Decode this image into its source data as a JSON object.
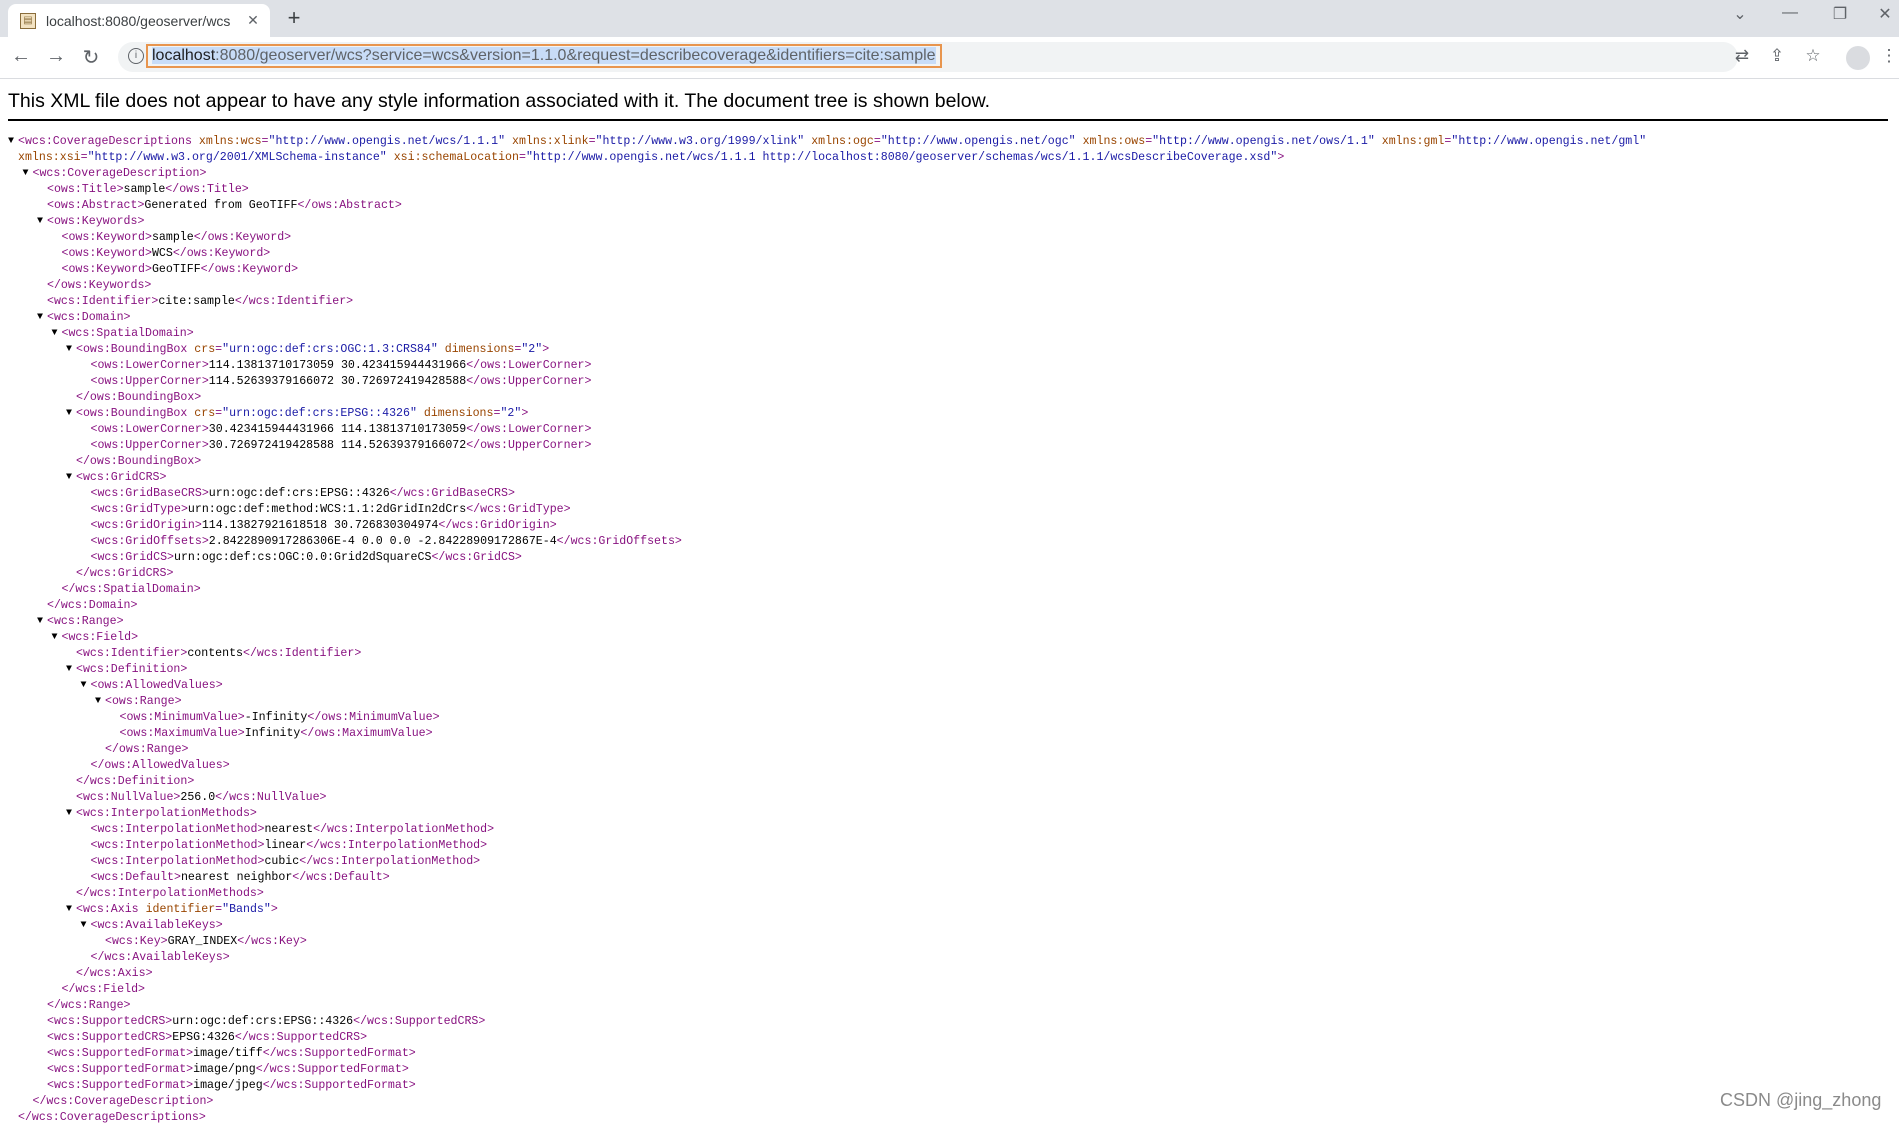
{
  "browser": {
    "tab_title": "localhost:8080/geoserver/wcs",
    "url_host": "localhost",
    "url_rest": ":8080/geoserver/wcs?service=wcs&version=1.1.0&request=describecoverage&identifiers=cite:sample"
  },
  "notice": "This XML file does not appear to have any style information associated with it. The document tree is shown below.",
  "watermark": "CSDN @jing_zhong",
  "icons": {
    "new_tab": "+",
    "tab_close": "✕",
    "back": "←",
    "forward": "→",
    "reload": "↻",
    "minimize": "—",
    "restore": "❐",
    "close": "✕",
    "dropdown": "⌄",
    "translate": "⇄",
    "share": "⇪",
    "star": "☆",
    "menu": "⋮",
    "info": "i",
    "toggle_open": "▼"
  },
  "xml_lines": [
    {
      "indent": 0,
      "toggle": true,
      "parts": [
        {
          "t": "tag",
          "v": "<wcs:CoverageDescriptions "
        },
        {
          "t": "an",
          "v": "xmlns:wcs"
        },
        {
          "t": "tag",
          "v": "="
        },
        {
          "t": "av",
          "v": "\"http://www.opengis.net/wcs/1.1.1\""
        },
        {
          "t": "an",
          "v": " xmlns:xlink"
        },
        {
          "t": "tag",
          "v": "="
        },
        {
          "t": "av",
          "v": "\"http://www.w3.org/1999/xlink\""
        },
        {
          "t": "an",
          "v": " xmlns:ogc"
        },
        {
          "t": "tag",
          "v": "="
        },
        {
          "t": "av",
          "v": "\"http://www.opengis.net/ogc\""
        },
        {
          "t": "an",
          "v": " xmlns:ows"
        },
        {
          "t": "tag",
          "v": "="
        },
        {
          "t": "av",
          "v": "\"http://www.opengis.net/ows/1.1\""
        },
        {
          "t": "an",
          "v": " xmlns:gml"
        },
        {
          "t": "tag",
          "v": "="
        },
        {
          "t": "av",
          "v": "\"http://www.opengis.net/gml\""
        }
      ]
    },
    {
      "indent": 0,
      "toggle": false,
      "parts": [
        {
          "t": "an",
          "v": "xmlns:xsi"
        },
        {
          "t": "tag",
          "v": "="
        },
        {
          "t": "av",
          "v": "\"http://www.w3.org/2001/XMLSchema-instance\""
        },
        {
          "t": "an",
          "v": " xsi:schemaLocation"
        },
        {
          "t": "tag",
          "v": "="
        },
        {
          "t": "av",
          "v": "\"http://www.opengis.net/wcs/1.1.1 http://localhost:8080/geoserver/schemas/wcs/1.1.1/wcsDescribeCoverage.xsd\""
        },
        {
          "t": "tag",
          "v": ">"
        }
      ]
    },
    {
      "indent": 1,
      "toggle": true,
      "parts": [
        {
          "t": "tag",
          "v": "<wcs:CoverageDescription>"
        }
      ]
    },
    {
      "indent": 2,
      "toggle": false,
      "parts": [
        {
          "t": "tag",
          "v": "<ows:Title>"
        },
        {
          "t": "txt",
          "v": "sample"
        },
        {
          "t": "tag",
          "v": "</ows:Title>"
        }
      ]
    },
    {
      "indent": 2,
      "toggle": false,
      "parts": [
        {
          "t": "tag",
          "v": "<ows:Abstract>"
        },
        {
          "t": "txt",
          "v": "Generated from GeoTIFF"
        },
        {
          "t": "tag",
          "v": "</ows:Abstract>"
        }
      ]
    },
    {
      "indent": 2,
      "toggle": true,
      "parts": [
        {
          "t": "tag",
          "v": "<ows:Keywords>"
        }
      ]
    },
    {
      "indent": 3,
      "toggle": false,
      "parts": [
        {
          "t": "tag",
          "v": "<ows:Keyword>"
        },
        {
          "t": "txt",
          "v": "sample"
        },
        {
          "t": "tag",
          "v": "</ows:Keyword>"
        }
      ]
    },
    {
      "indent": 3,
      "toggle": false,
      "parts": [
        {
          "t": "tag",
          "v": "<ows:Keyword>"
        },
        {
          "t": "txt",
          "v": "WCS"
        },
        {
          "t": "tag",
          "v": "</ows:Keyword>"
        }
      ]
    },
    {
      "indent": 3,
      "toggle": false,
      "parts": [
        {
          "t": "tag",
          "v": "<ows:Keyword>"
        },
        {
          "t": "txt",
          "v": "GeoTIFF"
        },
        {
          "t": "tag",
          "v": "</ows:Keyword>"
        }
      ]
    },
    {
      "indent": 2,
      "toggle": false,
      "parts": [
        {
          "t": "tag",
          "v": "</ows:Keywords>"
        }
      ]
    },
    {
      "indent": 2,
      "toggle": false,
      "parts": [
        {
          "t": "tag",
          "v": "<wcs:Identifier>"
        },
        {
          "t": "txt",
          "v": "cite:sample"
        },
        {
          "t": "tag",
          "v": "</wcs:Identifier>"
        }
      ]
    },
    {
      "indent": 2,
      "toggle": true,
      "parts": [
        {
          "t": "tag",
          "v": "<wcs:Domain>"
        }
      ]
    },
    {
      "indent": 3,
      "toggle": true,
      "parts": [
        {
          "t": "tag",
          "v": "<wcs:SpatialDomain>"
        }
      ]
    },
    {
      "indent": 4,
      "toggle": true,
      "parts": [
        {
          "t": "tag",
          "v": "<ows:BoundingBox "
        },
        {
          "t": "an",
          "v": "crs"
        },
        {
          "t": "tag",
          "v": "="
        },
        {
          "t": "av",
          "v": "\"urn:ogc:def:crs:OGC:1.3:CRS84\""
        },
        {
          "t": "an",
          "v": " dimensions"
        },
        {
          "t": "tag",
          "v": "="
        },
        {
          "t": "av",
          "v": "\"2\""
        },
        {
          "t": "tag",
          "v": ">"
        }
      ]
    },
    {
      "indent": 5,
      "toggle": false,
      "parts": [
        {
          "t": "tag",
          "v": "<ows:LowerCorner>"
        },
        {
          "t": "txt",
          "v": "114.13813710173059 30.423415944431966"
        },
        {
          "t": "tag",
          "v": "</ows:LowerCorner>"
        }
      ]
    },
    {
      "indent": 5,
      "toggle": false,
      "parts": [
        {
          "t": "tag",
          "v": "<ows:UpperCorner>"
        },
        {
          "t": "txt",
          "v": "114.52639379166072 30.726972419428588"
        },
        {
          "t": "tag",
          "v": "</ows:UpperCorner>"
        }
      ]
    },
    {
      "indent": 4,
      "toggle": false,
      "parts": [
        {
          "t": "tag",
          "v": "</ows:BoundingBox>"
        }
      ]
    },
    {
      "indent": 4,
      "toggle": true,
      "parts": [
        {
          "t": "tag",
          "v": "<ows:BoundingBox "
        },
        {
          "t": "an",
          "v": "crs"
        },
        {
          "t": "tag",
          "v": "="
        },
        {
          "t": "av",
          "v": "\"urn:ogc:def:crs:EPSG::4326\""
        },
        {
          "t": "an",
          "v": " dimensions"
        },
        {
          "t": "tag",
          "v": "="
        },
        {
          "t": "av",
          "v": "\"2\""
        },
        {
          "t": "tag",
          "v": ">"
        }
      ]
    },
    {
      "indent": 5,
      "toggle": false,
      "parts": [
        {
          "t": "tag",
          "v": "<ows:LowerCorner>"
        },
        {
          "t": "txt",
          "v": "30.423415944431966 114.13813710173059"
        },
        {
          "t": "tag",
          "v": "</ows:LowerCorner>"
        }
      ]
    },
    {
      "indent": 5,
      "toggle": false,
      "parts": [
        {
          "t": "tag",
          "v": "<ows:UpperCorner>"
        },
        {
          "t": "txt",
          "v": "30.726972419428588 114.52639379166072"
        },
        {
          "t": "tag",
          "v": "</ows:UpperCorner>"
        }
      ]
    },
    {
      "indent": 4,
      "toggle": false,
      "parts": [
        {
          "t": "tag",
          "v": "</ows:BoundingBox>"
        }
      ]
    },
    {
      "indent": 4,
      "toggle": true,
      "parts": [
        {
          "t": "tag",
          "v": "<wcs:GridCRS>"
        }
      ]
    },
    {
      "indent": 5,
      "toggle": false,
      "parts": [
        {
          "t": "tag",
          "v": "<wcs:GridBaseCRS>"
        },
        {
          "t": "txt",
          "v": "urn:ogc:def:crs:EPSG::4326"
        },
        {
          "t": "tag",
          "v": "</wcs:GridBaseCRS>"
        }
      ]
    },
    {
      "indent": 5,
      "toggle": false,
      "parts": [
        {
          "t": "tag",
          "v": "<wcs:GridType>"
        },
        {
          "t": "txt",
          "v": "urn:ogc:def:method:WCS:1.1:2dGridIn2dCrs"
        },
        {
          "t": "tag",
          "v": "</wcs:GridType>"
        }
      ]
    },
    {
      "indent": 5,
      "toggle": false,
      "parts": [
        {
          "t": "tag",
          "v": "<wcs:GridOrigin>"
        },
        {
          "t": "txt",
          "v": "114.13827921618518 30.726830304974"
        },
        {
          "t": "tag",
          "v": "</wcs:GridOrigin>"
        }
      ]
    },
    {
      "indent": 5,
      "toggle": false,
      "parts": [
        {
          "t": "tag",
          "v": "<wcs:GridOffsets>"
        },
        {
          "t": "txt",
          "v": "2.8422890917286306E-4 0.0 0.0 -2.84228909172867E-4"
        },
        {
          "t": "tag",
          "v": "</wcs:GridOffsets>"
        }
      ]
    },
    {
      "indent": 5,
      "toggle": false,
      "parts": [
        {
          "t": "tag",
          "v": "<wcs:GridCS>"
        },
        {
          "t": "txt",
          "v": "urn:ogc:def:cs:OGC:0.0:Grid2dSquareCS"
        },
        {
          "t": "tag",
          "v": "</wcs:GridCS>"
        }
      ]
    },
    {
      "indent": 4,
      "toggle": false,
      "parts": [
        {
          "t": "tag",
          "v": "</wcs:GridCRS>"
        }
      ]
    },
    {
      "indent": 3,
      "toggle": false,
      "parts": [
        {
          "t": "tag",
          "v": "</wcs:SpatialDomain>"
        }
      ]
    },
    {
      "indent": 2,
      "toggle": false,
      "parts": [
        {
          "t": "tag",
          "v": "</wcs:Domain>"
        }
      ]
    },
    {
      "indent": 2,
      "toggle": true,
      "parts": [
        {
          "t": "tag",
          "v": "<wcs:Range>"
        }
      ]
    },
    {
      "indent": 3,
      "toggle": true,
      "parts": [
        {
          "t": "tag",
          "v": "<wcs:Field>"
        }
      ]
    },
    {
      "indent": 4,
      "toggle": false,
      "parts": [
        {
          "t": "tag",
          "v": "<wcs:Identifier>"
        },
        {
          "t": "txt",
          "v": "contents"
        },
        {
          "t": "tag",
          "v": "</wcs:Identifier>"
        }
      ]
    },
    {
      "indent": 4,
      "toggle": true,
      "parts": [
        {
          "t": "tag",
          "v": "<wcs:Definition>"
        }
      ]
    },
    {
      "indent": 5,
      "toggle": true,
      "parts": [
        {
          "t": "tag",
          "v": "<ows:AllowedValues>"
        }
      ]
    },
    {
      "indent": 6,
      "toggle": true,
      "parts": [
        {
          "t": "tag",
          "v": "<ows:Range>"
        }
      ]
    },
    {
      "indent": 7,
      "toggle": false,
      "parts": [
        {
          "t": "tag",
          "v": "<ows:MinimumValue>"
        },
        {
          "t": "txt",
          "v": "-Infinity"
        },
        {
          "t": "tag",
          "v": "</ows:MinimumValue>"
        }
      ]
    },
    {
      "indent": 7,
      "toggle": false,
      "parts": [
        {
          "t": "tag",
          "v": "<ows:MaximumValue>"
        },
        {
          "t": "txt",
          "v": "Infinity"
        },
        {
          "t": "tag",
          "v": "</ows:MaximumValue>"
        }
      ]
    },
    {
      "indent": 6,
      "toggle": false,
      "parts": [
        {
          "t": "tag",
          "v": "</ows:Range>"
        }
      ]
    },
    {
      "indent": 5,
      "toggle": false,
      "parts": [
        {
          "t": "tag",
          "v": "</ows:AllowedValues>"
        }
      ]
    },
    {
      "indent": 4,
      "toggle": false,
      "parts": [
        {
          "t": "tag",
          "v": "</wcs:Definition>"
        }
      ]
    },
    {
      "indent": 4,
      "toggle": false,
      "parts": [
        {
          "t": "tag",
          "v": "<wcs:NullValue>"
        },
        {
          "t": "txt",
          "v": "256.0"
        },
        {
          "t": "tag",
          "v": "</wcs:NullValue>"
        }
      ]
    },
    {
      "indent": 4,
      "toggle": true,
      "parts": [
        {
          "t": "tag",
          "v": "<wcs:InterpolationMethods>"
        }
      ]
    },
    {
      "indent": 5,
      "toggle": false,
      "parts": [
        {
          "t": "tag",
          "v": "<wcs:InterpolationMethod>"
        },
        {
          "t": "txt",
          "v": "nearest"
        },
        {
          "t": "tag",
          "v": "</wcs:InterpolationMethod>"
        }
      ]
    },
    {
      "indent": 5,
      "toggle": false,
      "parts": [
        {
          "t": "tag",
          "v": "<wcs:InterpolationMethod>"
        },
        {
          "t": "txt",
          "v": "linear"
        },
        {
          "t": "tag",
          "v": "</wcs:InterpolationMethod>"
        }
      ]
    },
    {
      "indent": 5,
      "toggle": false,
      "parts": [
        {
          "t": "tag",
          "v": "<wcs:InterpolationMethod>"
        },
        {
          "t": "txt",
          "v": "cubic"
        },
        {
          "t": "tag",
          "v": "</wcs:InterpolationMethod>"
        }
      ]
    },
    {
      "indent": 5,
      "toggle": false,
      "parts": [
        {
          "t": "tag",
          "v": "<wcs:Default>"
        },
        {
          "t": "txt",
          "v": "nearest neighbor"
        },
        {
          "t": "tag",
          "v": "</wcs:Default>"
        }
      ]
    },
    {
      "indent": 4,
      "toggle": false,
      "parts": [
        {
          "t": "tag",
          "v": "</wcs:InterpolationMethods>"
        }
      ]
    },
    {
      "indent": 4,
      "toggle": true,
      "parts": [
        {
          "t": "tag",
          "v": "<wcs:Axis "
        },
        {
          "t": "an",
          "v": "identifier"
        },
        {
          "t": "tag",
          "v": "="
        },
        {
          "t": "av",
          "v": "\"Bands\""
        },
        {
          "t": "tag",
          "v": ">"
        }
      ]
    },
    {
      "indent": 5,
      "toggle": true,
      "parts": [
        {
          "t": "tag",
          "v": "<wcs:AvailableKeys>"
        }
      ]
    },
    {
      "indent": 6,
      "toggle": false,
      "parts": [
        {
          "t": "tag",
          "v": "<wcs:Key>"
        },
        {
          "t": "txt",
          "v": "GRAY_INDEX"
        },
        {
          "t": "tag",
          "v": "</wcs:Key>"
        }
      ]
    },
    {
      "indent": 5,
      "toggle": false,
      "parts": [
        {
          "t": "tag",
          "v": "</wcs:AvailableKeys>"
        }
      ]
    },
    {
      "indent": 4,
      "toggle": false,
      "parts": [
        {
          "t": "tag",
          "v": "</wcs:Axis>"
        }
      ]
    },
    {
      "indent": 3,
      "toggle": false,
      "parts": [
        {
          "t": "tag",
          "v": "</wcs:Field>"
        }
      ]
    },
    {
      "indent": 2,
      "toggle": false,
      "parts": [
        {
          "t": "tag",
          "v": "</wcs:Range>"
        }
      ]
    },
    {
      "indent": 2,
      "toggle": false,
      "parts": [
        {
          "t": "tag",
          "v": "<wcs:SupportedCRS>"
        },
        {
          "t": "txt",
          "v": "urn:ogc:def:crs:EPSG::4326"
        },
        {
          "t": "tag",
          "v": "</wcs:SupportedCRS>"
        }
      ]
    },
    {
      "indent": 2,
      "toggle": false,
      "parts": [
        {
          "t": "tag",
          "v": "<wcs:SupportedCRS>"
        },
        {
          "t": "txt",
          "v": "EPSG:4326"
        },
        {
          "t": "tag",
          "v": "</wcs:SupportedCRS>"
        }
      ]
    },
    {
      "indent": 2,
      "toggle": false,
      "parts": [
        {
          "t": "tag",
          "v": "<wcs:SupportedFormat>"
        },
        {
          "t": "txt",
          "v": "image/tiff"
        },
        {
          "t": "tag",
          "v": "</wcs:SupportedFormat>"
        }
      ]
    },
    {
      "indent": 2,
      "toggle": false,
      "parts": [
        {
          "t": "tag",
          "v": "<wcs:SupportedFormat>"
        },
        {
          "t": "txt",
          "v": "image/png"
        },
        {
          "t": "tag",
          "v": "</wcs:SupportedFormat>"
        }
      ]
    },
    {
      "indent": 2,
      "toggle": false,
      "parts": [
        {
          "t": "tag",
          "v": "<wcs:SupportedFormat>"
        },
        {
          "t": "txt",
          "v": "image/jpeg"
        },
        {
          "t": "tag",
          "v": "</wcs:SupportedFormat>"
        }
      ]
    },
    {
      "indent": 1,
      "toggle": false,
      "parts": [
        {
          "t": "tag",
          "v": "</wcs:CoverageDescription>"
        }
      ]
    },
    {
      "indent": 0,
      "toggle": false,
      "parts": [
        {
          "t": "tag",
          "v": "</wcs:CoverageDescriptions>"
        }
      ]
    }
  ]
}
